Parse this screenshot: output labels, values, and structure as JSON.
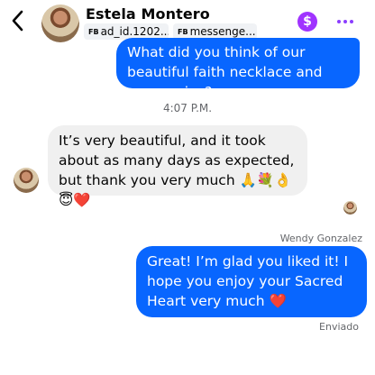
{
  "header": {
    "contact_name": "Estela Montero",
    "tags": [
      {
        "badge": "FB",
        "label": "ad_id.1202..."
      },
      {
        "badge": "FB",
        "label": "messenge..."
      }
    ],
    "payment_icon": "dollar-icon",
    "more_icon": "more-dots-icon",
    "back_icon": "back-chevron-icon"
  },
  "messages": [
    {
      "direction": "outgoing",
      "text": "What did you think of our beautiful faith necklace and our service?"
    },
    {
      "direction": "timestamp",
      "text": "4:07 P.M."
    },
    {
      "direction": "incoming",
      "text": "It’s very beautiful, and it took about as many days as expected, but thank you very much 🙏💐👌😇❤️"
    },
    {
      "direction": "sender",
      "text": "Wendy Gonzalez"
    },
    {
      "direction": "outgoing",
      "text": "Great! I’m glad you liked it! I hope you enjoy your Sacred Heart very much ❤️"
    },
    {
      "direction": "status",
      "text": "Enviado"
    }
  ],
  "colors": {
    "outgoing_bubble": "#0866ff",
    "incoming_bubble": "#f0f0f0",
    "accent_purple": "#a033ff",
    "muted_text": "#65676b"
  }
}
